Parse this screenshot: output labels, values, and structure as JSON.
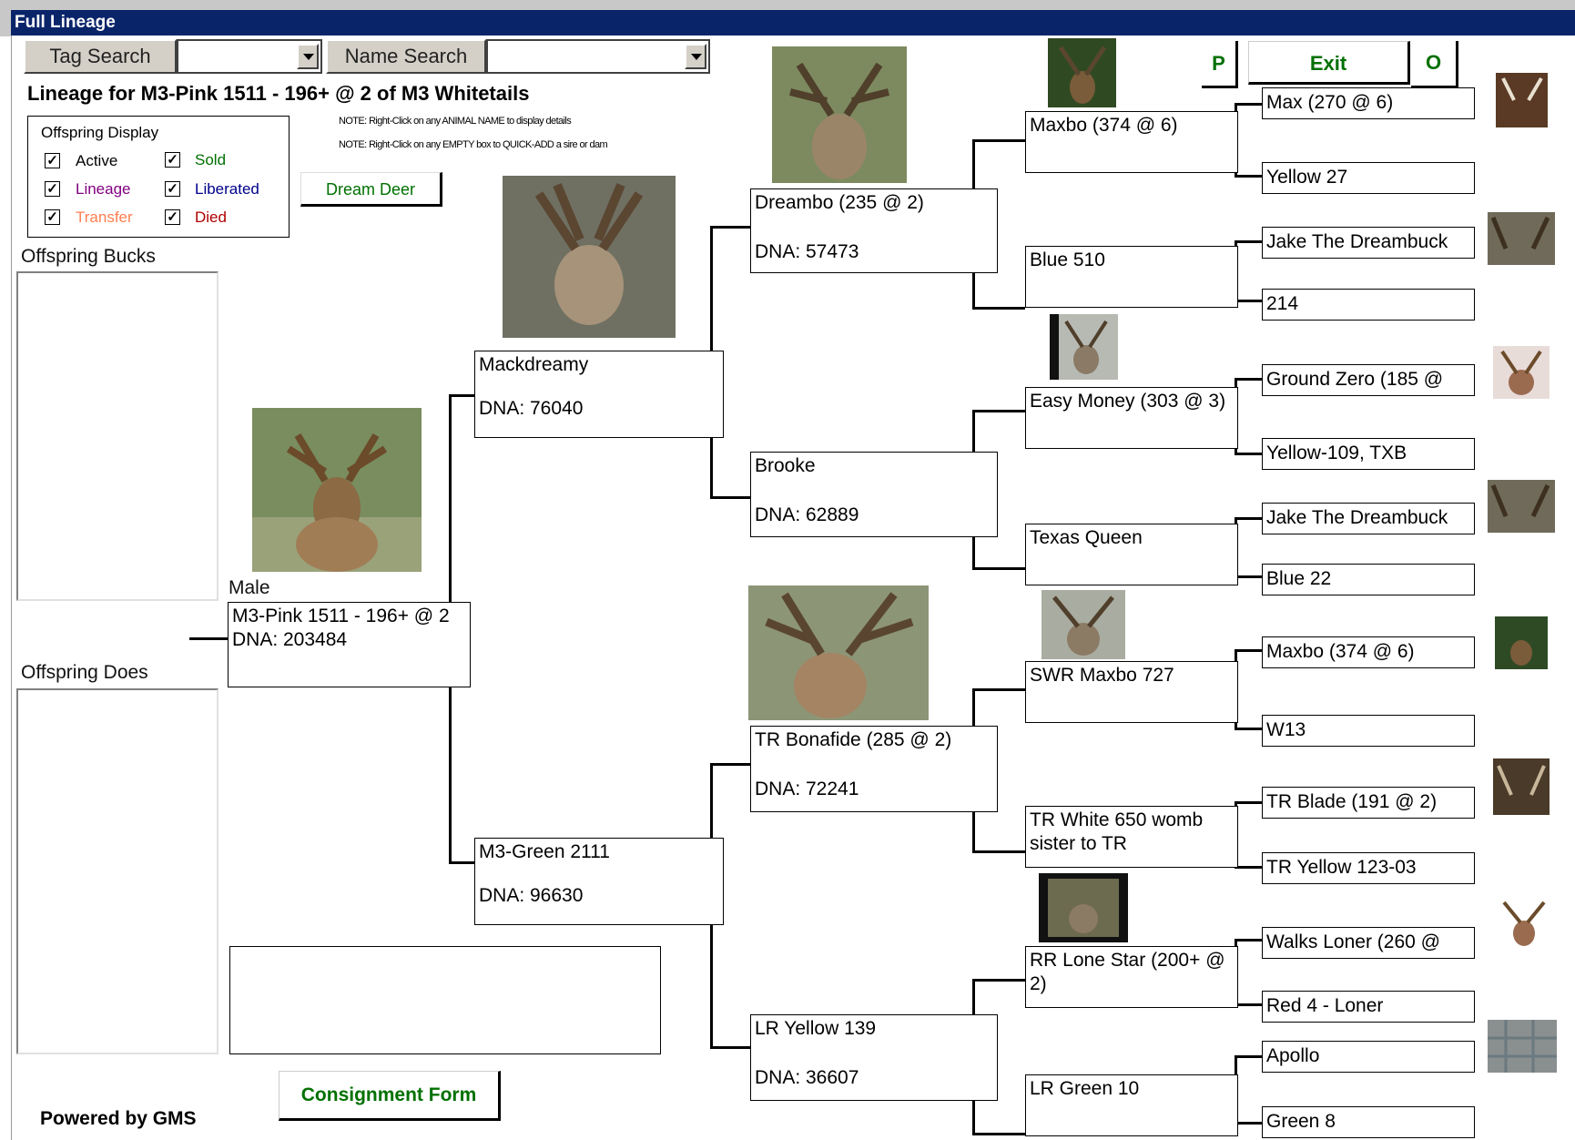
{
  "window": {
    "title": "Full Lineage"
  },
  "search": {
    "tag_label": "Tag Search",
    "name_label": "Name Search"
  },
  "heading": "Lineage for M3-Pink 1511 - 196+ @ 2 of M3 Whitetails",
  "notes": [
    "NOTE: Right-Click on any ANIMAL NAME to display details",
    "NOTE: Right-Click on any EMPTY box to QUICK-ADD a sire or dam"
  ],
  "legend": {
    "title": "Offspring Display",
    "items": [
      {
        "label": "Active",
        "color": "#000000",
        "checked": true
      },
      {
        "label": "Sold",
        "color": "#007000",
        "checked": true
      },
      {
        "label": "Lineage",
        "color": "#800080",
        "checked": true
      },
      {
        "label": "Liberated",
        "color": "#00008b",
        "checked": true
      },
      {
        "label": "Transfer",
        "color": "#ff7f50",
        "checked": true
      },
      {
        "label": "Died",
        "color": "#b00000",
        "checked": true
      }
    ]
  },
  "buttons": {
    "dream_deer": "Dream Deer",
    "p": "P",
    "exit": "Exit",
    "o": "O",
    "consignment": "Consignment Form"
  },
  "lists": {
    "bucks_label": "Offspring Bucks",
    "does_label": "Offspring Does"
  },
  "subject": {
    "sex": "Male",
    "name": "M3-Pink 1511 - 196+ @ 2",
    "dna": "DNA: 203484"
  },
  "gen1": [
    {
      "name": "Mackdreamy",
      "dna": "DNA: 76040"
    },
    {
      "name": "M3-Green 2111",
      "dna": "DNA: 96630"
    }
  ],
  "gen2": [
    {
      "name": "Dreambo (235 @ 2)",
      "dna": "DNA: 57473"
    },
    {
      "name": "Brooke",
      "dna": "DNA: 62889"
    },
    {
      "name": "TR Bonafide (285 @ 2)",
      "dna": "DNA: 72241"
    },
    {
      "name": "LR Yellow 139",
      "dna": "DNA: 36607"
    }
  ],
  "gen3": [
    {
      "name": "Maxbo (374 @ 6)"
    },
    {
      "name": "Blue 510"
    },
    {
      "name": "Easy Money (303 @ 3)"
    },
    {
      "name": "Texas Queen"
    },
    {
      "name": "SWR Maxbo 727"
    },
    {
      "name": "TR White 650 womb sister to TR"
    },
    {
      "name": "RR Lone Star (200+ @ 2)"
    },
    {
      "name": "LR Green 10"
    }
  ],
  "gen4": [
    {
      "name": "Max (270 @ 6)"
    },
    {
      "name": "Yellow 27"
    },
    {
      "name": "Jake The Dreambuck"
    },
    {
      "name": "214"
    },
    {
      "name": "Ground Zero (185 @"
    },
    {
      "name": "Yellow-109, TXB"
    },
    {
      "name": "Jake The Dreambuck"
    },
    {
      "name": "Blue 22"
    },
    {
      "name": "Maxbo (374 @ 6)"
    },
    {
      "name": "W13"
    },
    {
      "name": "TR Blade (191 @ 2)"
    },
    {
      "name": "TR Yellow 123-03"
    },
    {
      "name": "Walks Loner (260 @"
    },
    {
      "name": "Red 4 - Loner"
    },
    {
      "name": "Apollo"
    },
    {
      "name": "Green 8"
    }
  ],
  "footer": {
    "powered": "Powered by GMS"
  }
}
